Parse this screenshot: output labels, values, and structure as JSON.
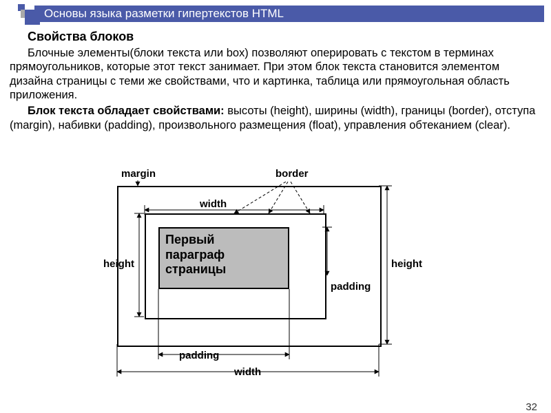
{
  "header": {
    "title": "Основы языка разметки гипертекстов HTML"
  },
  "body": {
    "heading": "Свойства блоков",
    "p1a": "Блочные элементы(блоки текста или box) позволяют оперировать с текстом в терминах прямоугольников, которые этот текст занимает. При этом блок текста становится элементом дизайна страницы с теми же свойствами, что и картинка, таблица или прямоугольная область приложения.",
    "p2_lead": "Блок текста обладает свойствами:",
    "p2_rest": " высоты (height), ширины (width), границы (border), отступа (margin), набивки (padding), произвольного размещения (float), управления обтеканием (clear)."
  },
  "diagram": {
    "margin": "margin",
    "border": "border",
    "width_top": "width",
    "width_bottom": "width",
    "height_left": "height",
    "height_right": "height",
    "padding_right": "padding",
    "padding_bottom": "padding",
    "content_l1": "Первый",
    "content_l2": "параграф",
    "content_l3": "страницы"
  },
  "page_number": "32"
}
